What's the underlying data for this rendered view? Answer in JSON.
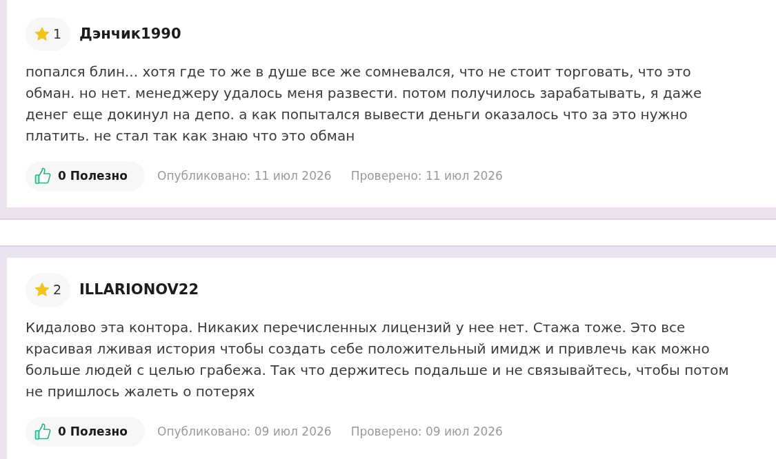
{
  "reviews": [
    {
      "rank": "1",
      "author": "Дэнчик1990",
      "text": "попался блин... хотя где то же в душе все же сомневался, что не стоит торговать, что это обман. но нет. менеджеру удалось меня развести. потом получилось зарабатывать, я даже денег еще докинул на депо. а как попытался вывести деньги оказалось что за это нужно платить. не стал так как знаю что это обман",
      "helpful": "0 Полезно",
      "published": "Опубликовано: 11 июл 2026",
      "verified": "Проверено: 11 июл 2026"
    },
    {
      "rank": "2",
      "author": "ILLARIONOV22",
      "text": "Кидалово эта контора. Никаких перечисленных лицензий у нее нет. Стажа тоже. Это все красивая лживая история чтобы создать себе положительный имидж и привлечь как можно больше людей с целью грабежа. Так что держитесь подальше и не связывайтесь, чтобы потом не пришлось жалеть о потерях",
      "helpful": "0 Полезно",
      "published": "Опубликовано: 09 июл 2026",
      "verified": "Проверено: 09 июл 2026"
    }
  ]
}
